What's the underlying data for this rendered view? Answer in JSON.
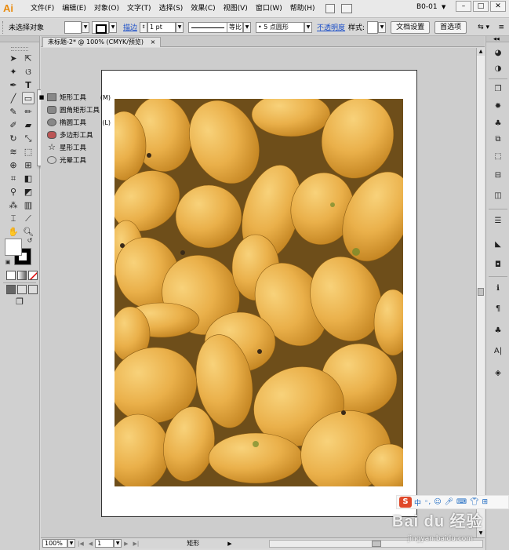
{
  "app": {
    "logo": "Ai",
    "menu": [
      "文件(F)",
      "编辑(E)",
      "对象(O)",
      "文字(T)",
      "选择(S)",
      "效果(C)",
      "视图(V)",
      "窗口(W)",
      "帮助(H)"
    ],
    "workspace": "B0-01",
    "window_controls": [
      "–",
      "□",
      "✕"
    ]
  },
  "control_bar": {
    "selection": "未选择对象",
    "stroke_link": "描边",
    "stroke_weight": "1 pt",
    "profile": "等比",
    "brush": "5 点圆形",
    "opacity_link": "不透明度",
    "style_label": "样式:",
    "doc_setup": "文档设置",
    "preferences": "首选项"
  },
  "document": {
    "tab_title": "未标题-2* @ 100% (CMYK/预览)",
    "close": "×"
  },
  "flyout": {
    "items": [
      {
        "label": "矩形工具",
        "shortcut": "(M)",
        "icon": "rectangle-icon",
        "current": true
      },
      {
        "label": "圆角矩形工具",
        "shortcut": "",
        "icon": "rounded-rectangle-icon"
      },
      {
        "label": "椭圆工具",
        "shortcut": "(L)",
        "icon": "ellipse-icon"
      },
      {
        "label": "多边形工具",
        "shortcut": "",
        "icon": "polygon-icon",
        "highlighted": true
      },
      {
        "label": "星形工具",
        "shortcut": "",
        "icon": "star-icon"
      },
      {
        "label": "光晕工具",
        "shortcut": "",
        "icon": "flare-icon"
      }
    ]
  },
  "status_bar": {
    "zoom": "100%",
    "page": "1",
    "current_tool": "矩形"
  },
  "watermark": {
    "toolbar_text": "中",
    "logo": "Bai du 经验",
    "url": "jingyan.baidu.com"
  },
  "colors": {
    "accent_link": "#1b4fc8",
    "highlight": "#f28b93",
    "ai_orange": "#e98b0e"
  }
}
